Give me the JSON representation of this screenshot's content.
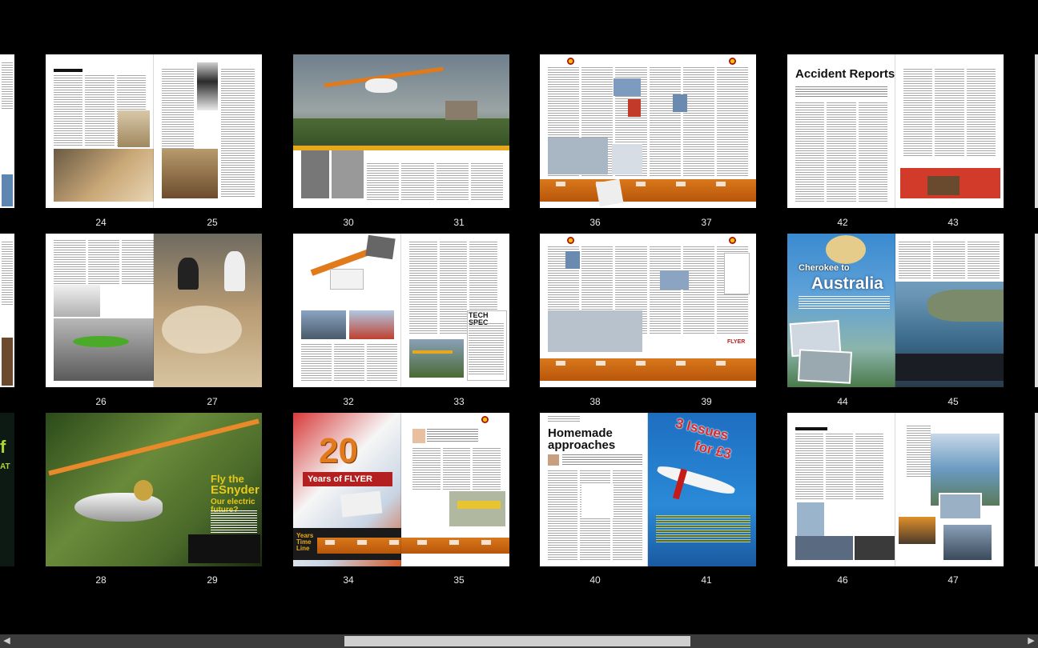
{
  "viewer": {
    "rows": [
      [
        {
          "left": "24",
          "right": "25"
        },
        {
          "left": "30",
          "right": "31"
        },
        {
          "left": "36",
          "right": "37"
        },
        {
          "left": "42",
          "right": "43"
        }
      ],
      [
        {
          "left": "26",
          "right": "27"
        },
        {
          "left": "32",
          "right": "33"
        },
        {
          "left": "38",
          "right": "39"
        },
        {
          "left": "44",
          "right": "45"
        }
      ],
      [
        {
          "left": "28",
          "right": "29"
        },
        {
          "left": "34",
          "right": "35"
        },
        {
          "left": "40",
          "right": "41"
        },
        {
          "left": "46",
          "right": "47"
        }
      ]
    ]
  },
  "headlines": {
    "accident_reports": "Accident Reports",
    "cherokee_to": "Cherokee to",
    "australia": "Australia",
    "tech_spec": "TECH SPEC",
    "fly_the": "Fly the",
    "esnyder": "ESnyder",
    "electric_future": "Our electric future?",
    "twenty": "20",
    "years_of_flyer": "Years of FLYER",
    "years_time_line": "Years\nTime\nLine",
    "homemade": "Homemade",
    "approaches": "approaches",
    "three_issues": "3 Issues",
    "for_three": "for £3",
    "flyer_logo": "FLYER"
  },
  "scrollbar": {
    "left_arrow": "◀",
    "right_arrow": "▶"
  },
  "colors": {
    "background": "#000000",
    "accent_orange": "#d9781c",
    "sky_blue": "#2a7fc8",
    "red": "#c41a1a"
  }
}
